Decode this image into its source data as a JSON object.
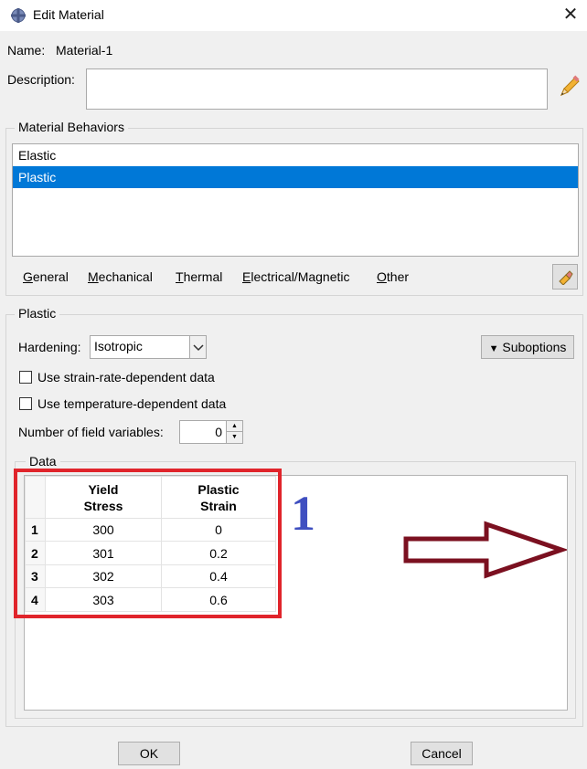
{
  "window": {
    "title": "Edit Material",
    "close_icon": "close-icon"
  },
  "name": {
    "label": "Name:",
    "value": "Material-1"
  },
  "description": {
    "label": "Description:",
    "value": ""
  },
  "behaviors": {
    "group_title": "Material Behaviors",
    "items": [
      {
        "label": "Elastic",
        "selected": false
      },
      {
        "label": "Plastic",
        "selected": true
      }
    ],
    "selection_color": "#0078d7"
  },
  "menu": {
    "general_u": "G",
    "general_rest": "eneral",
    "mechanical_u": "M",
    "mechanical_rest": "echanical",
    "thermal_u": "T",
    "thermal_rest": "hermal",
    "electrical_u": "E",
    "electrical_rest": "lectrical/Magnetic",
    "other_u": "O",
    "other_rest": "ther"
  },
  "plastic": {
    "group_title": "Plastic",
    "hardening_label": "Hardening:",
    "hardening_value": "Isotropic",
    "suboptions_label": "Suboptions",
    "strain_rate_label": "Use strain-rate-dependent data",
    "strain_rate_checked": false,
    "temperature_label": "Use temperature-dependent data",
    "temperature_checked": false,
    "field_vars_label": "Number of field variables:",
    "field_vars_value": "0"
  },
  "data_table": {
    "group_title": "Data",
    "columns": [
      {
        "line1": "Yield",
        "line2": "Stress"
      },
      {
        "line1": "Plastic",
        "line2": "Strain"
      }
    ],
    "rows": [
      {
        "index": "1",
        "stress": "300",
        "strain": "0"
      },
      {
        "index": "2",
        "stress": "301",
        "strain": "0.2"
      },
      {
        "index": "3",
        "stress": "302",
        "strain": "0.4"
      },
      {
        "index": "4",
        "stress": "303",
        "strain": "0.6"
      }
    ]
  },
  "annotation": {
    "number": "1",
    "number_color": "#3f4fc0",
    "box_color": "#e0242b",
    "arrow_color": "#7b1020"
  },
  "buttons": {
    "ok": "OK",
    "cancel": "Cancel"
  }
}
